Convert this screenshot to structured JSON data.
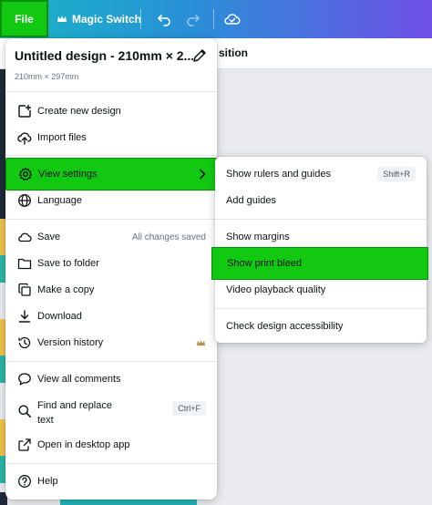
{
  "toolbar": {
    "file_label": "File",
    "magic_switch_label": "Magic Switch"
  },
  "background": {
    "header_fragment": "sition"
  },
  "file_menu": {
    "title": "Untitled design - 210mm × 2...",
    "dimensions": "210mm × 297mm",
    "items": {
      "create_new_design": "Create new design",
      "import_files": "Import files",
      "view_settings": "View settings",
      "language": "Language",
      "save": "Save",
      "save_status": "All changes saved",
      "save_to_folder": "Save to folder",
      "make_a_copy": "Make a copy",
      "download": "Download",
      "version_history": "Version history",
      "view_all_comments": "View all comments",
      "find_and_replace": "Find and replace text",
      "find_and_replace_shortcut": "Ctrl+F",
      "open_in_desktop_app": "Open in desktop app",
      "help": "Help"
    }
  },
  "view_settings_menu": {
    "items": {
      "show_rulers_and_guides": "Show rulers and guides",
      "show_rulers_shortcut": "Shift+R",
      "add_guides": "Add guides",
      "show_margins": "Show margins",
      "show_print_bleed": "Show print bleed",
      "video_playback_quality": "Video playback quality",
      "check_design_accessibility": "Check design accessibility"
    }
  },
  "colors": {
    "highlight": "#12c912",
    "highlight_border": "#0b8f0b",
    "toolbar_gradient_start": "#17b6c4",
    "toolbar_gradient_end": "#6f4fe6"
  }
}
